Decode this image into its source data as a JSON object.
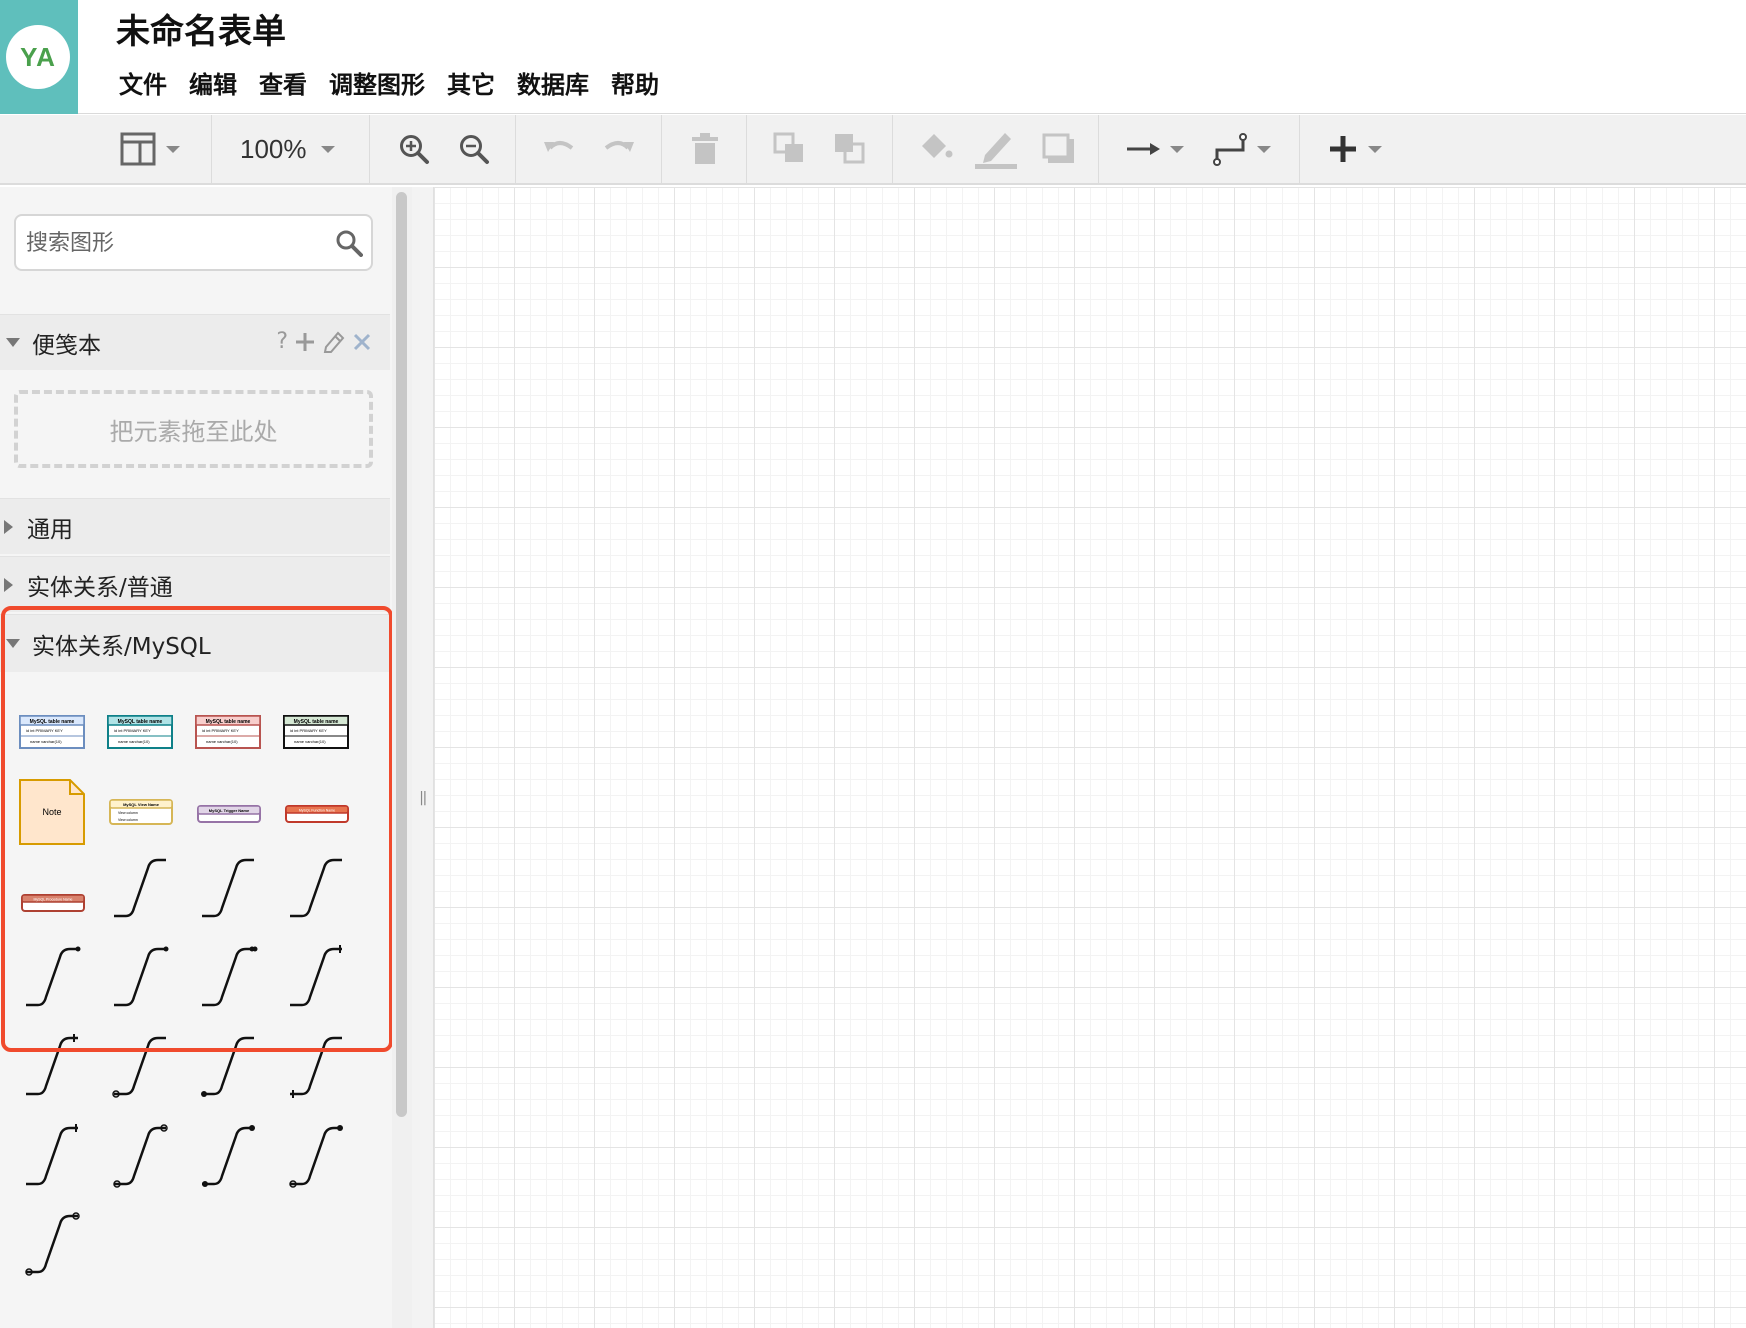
{
  "app": {
    "logo_text": "YA",
    "document_title": "未命名表单",
    "brand_color": "#5fbfbc"
  },
  "menu": [
    "文件",
    "编辑",
    "查看",
    "调整图形",
    "其它",
    "数据库",
    "帮助"
  ],
  "toolbar": {
    "zoom": "100%",
    "icons": [
      "format-panel-icon",
      "zoom-in-icon",
      "zoom-out-icon",
      "undo-icon",
      "redo-icon",
      "delete-icon",
      "to-front-icon",
      "to-back-icon",
      "fill-color-icon",
      "line-color-icon",
      "shadow-icon",
      "connection-icon",
      "waypoints-icon",
      "insert-icon"
    ]
  },
  "sidebar": {
    "search": {
      "placeholder": "搜索图形",
      "value": ""
    },
    "scratchpad": {
      "title": "便笺本",
      "help": "?",
      "drop_hint": "把元素拖至此处"
    },
    "sections": [
      {
        "label": "通用",
        "expanded": false
      },
      {
        "label": "实体关系/普通",
        "expanded": false
      },
      {
        "label": "实体关系/MySQL",
        "expanded": true
      }
    ],
    "mysql_shapes": {
      "table_title": "MySQL table name",
      "table_row1": "id int PRIMARY KEY",
      "table_row2": "name varchar(10)",
      "note_label": "Note",
      "view_title": "MySQL View Name",
      "view_row": "View column",
      "trigger_title": "MySQL Trigger Name",
      "procedure_title": "MySQL Procedure Name",
      "function_title": "MySQL Function Name"
    },
    "highlight_color": "#f04a2d"
  }
}
